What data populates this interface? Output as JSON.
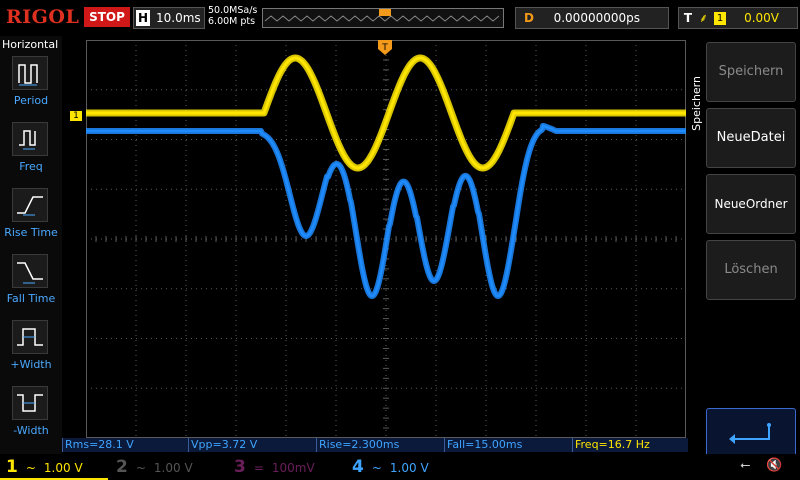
{
  "brand": "RIGOL",
  "run_state": "STOP",
  "timebase": {
    "label": "H",
    "value": "10.0ms"
  },
  "sampling": {
    "rate": "50.0MSa/s",
    "points": "6.00M pts"
  },
  "delay": {
    "label": "D",
    "value": "0.00000000ps"
  },
  "trigger": {
    "label": "T",
    "channel": "1",
    "level": "0.00V",
    "edge_icon": "rising-edge-icon"
  },
  "left_menu": {
    "title": "Horizontal",
    "items": [
      {
        "label": "Period",
        "icon": "period-icon"
      },
      {
        "label": "Freq",
        "icon": "freq-icon"
      },
      {
        "label": "Rise Time",
        "icon": "rise-time-icon"
      },
      {
        "label": "Fall Time",
        "icon": "fall-time-icon"
      },
      {
        "label": "+Width",
        "icon": "pos-width-icon"
      },
      {
        "label": "-Width",
        "icon": "neg-width-icon"
      }
    ]
  },
  "right_menu": {
    "title": "Speichern",
    "buttons": [
      "Speichern",
      "NeueDatei",
      "NeueOrdner",
      "Löschen"
    ],
    "return_icon": "return-icon"
  },
  "measurements": [
    {
      "text": "Rms=28.1 V",
      "color": "#3fa4ff"
    },
    {
      "text": "Vpp=3.72 V",
      "color": "#3fa4ff"
    },
    {
      "text": "Rise=2.300ms",
      "color": "#3fa4ff"
    },
    {
      "text": "Fall=15.00ms",
      "color": "#3fa4ff"
    },
    {
      "text": "Freq=16.7 Hz",
      "color": "#ffe600"
    }
  ],
  "channels": [
    {
      "num": "1",
      "coupling": "~",
      "scale": "1.00 V",
      "color": "#ffe600"
    },
    {
      "num": "2",
      "coupling": "~",
      "scale": "1.00 V",
      "color": "#555555"
    },
    {
      "num": "3",
      "coupling": "=",
      "scale": "100mV",
      "color": "#6a1e5a"
    },
    {
      "num": "4",
      "coupling": "~",
      "scale": "1.00 V",
      "color": "#3fa4ff"
    }
  ],
  "markers": {
    "ch1": "1",
    "trigger_pos": "T",
    "ch4_marker": "4"
  },
  "colors": {
    "ch1": "#ffe600",
    "ch4": "#1e8cff",
    "grid": "#5a5a5a",
    "background": "#000000"
  }
}
